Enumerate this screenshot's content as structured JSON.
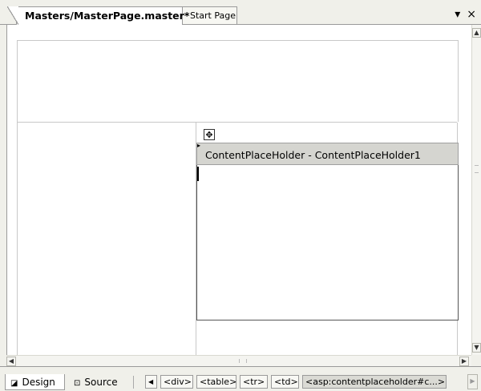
{
  "tabs": {
    "active_label": "Masters/MasterPage.master*",
    "inactive_label": "Start Page",
    "menu_icon": "▾",
    "close_icon": "×"
  },
  "designer": {
    "content_placeholder_label": "ContentPlaceHolder - ContentPlaceHolder1",
    "move_handle_icon": "move-icon"
  },
  "view_tabs": {
    "design_label": "Design",
    "source_label": "Source"
  },
  "tag_navigator": {
    "items": [
      "<div>",
      "<table>",
      "<tr>",
      "<td>",
      "<asp:contentplaceholder#c...>"
    ]
  },
  "colors": {
    "surface": "#ffffff",
    "chrome": "#f0f0ea",
    "placeholder_header": "#d5d5d0"
  }
}
